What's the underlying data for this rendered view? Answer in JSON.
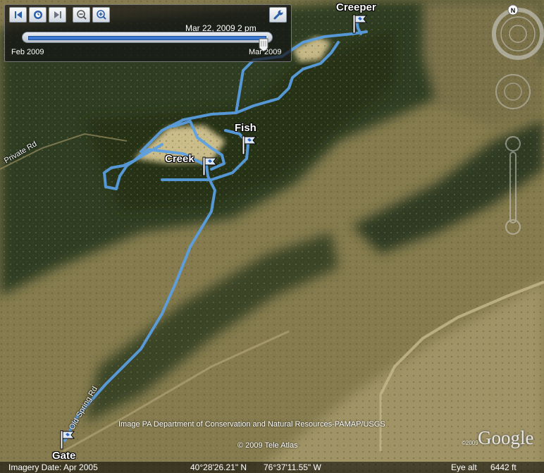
{
  "time_slider": {
    "current_time": "Mar 22, 2009   2 pm",
    "start_label": "Feb 2009",
    "end_label": "Mar 2009",
    "position": 0.97,
    "icons": [
      "skip-back-icon",
      "clock-icon",
      "skip-forward-icon",
      "zoom-out-icon",
      "zoom-in-icon",
      "wrench-icon"
    ]
  },
  "navigation": {
    "north_label": "N",
    "icons": [
      "look-joystick-icon",
      "move-joystick-icon",
      "zoom-slider-icon"
    ]
  },
  "road_labels": {
    "private_rd": "Private Rd",
    "old_spring_rd": "Old Spring Rd"
  },
  "placemarks": [
    {
      "label": "Creeper"
    },
    {
      "label": "Fish"
    },
    {
      "label": "Creek"
    },
    {
      "label": "Gate"
    }
  ],
  "attribution": {
    "imagery_credit": "Image PA Department of Conservation and Natural Resources-PAMAP/USGS",
    "copyright": "© 2009 Tele Atlas",
    "logo": "Google",
    "logo_small": "©2009"
  },
  "status_bar": {
    "imagery_date": "Imagery Date: Apr 2005",
    "latitude": "40°28'26.21\" N",
    "longitude": "76°37'11.55\" W",
    "eye_alt_label": "Eye alt",
    "eye_alt_value": "6442 ft"
  },
  "colors": {
    "track": "#5aa0e6",
    "forest": "#2c3a1f",
    "field": "#8e8455",
    "panel": "#222222"
  }
}
